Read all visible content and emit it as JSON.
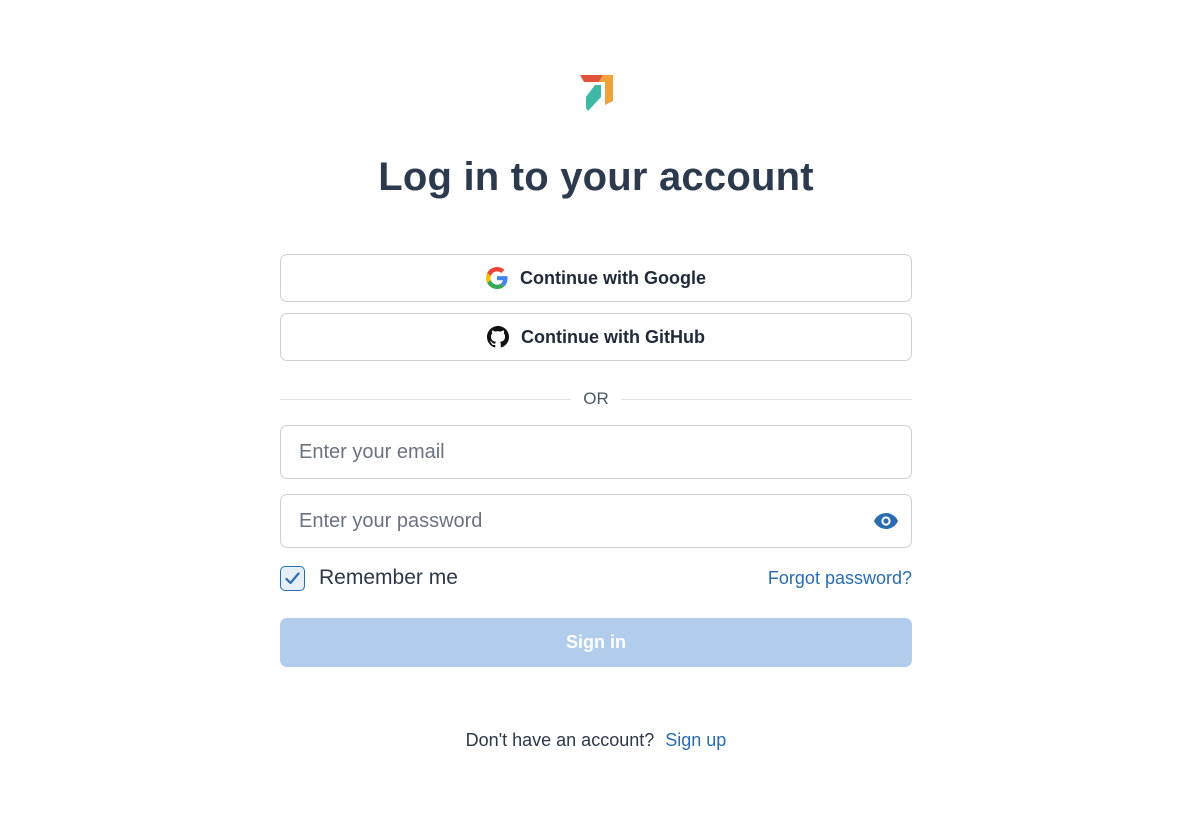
{
  "brand": {
    "logo_icon": "brand-logo-icon"
  },
  "page": {
    "title": "Log in to your account"
  },
  "oauth": {
    "google": {
      "label": "Continue with Google",
      "icon": "google-icon"
    },
    "github": {
      "label": "Continue with GitHub",
      "icon": "github-icon"
    }
  },
  "divider": {
    "text": "OR"
  },
  "form": {
    "email": {
      "placeholder": "Enter your email",
      "value": ""
    },
    "password": {
      "placeholder": "Enter your password",
      "value": "",
      "toggle_icon": "eye-icon"
    },
    "remember": {
      "label": "Remember me",
      "checked": true
    },
    "forgot_label": "Forgot password?",
    "submit_label": "Sign in"
  },
  "footer": {
    "prompt": "Don't have an account?",
    "signup_label": "Sign up"
  },
  "colors": {
    "accent": "#2b6cb0",
    "submit_disabled": "#b1cdeb",
    "title": "#2d3a4e",
    "logo_orange": "#f0a13a",
    "logo_red": "#e0523a",
    "logo_teal": "#3cb8a4"
  }
}
